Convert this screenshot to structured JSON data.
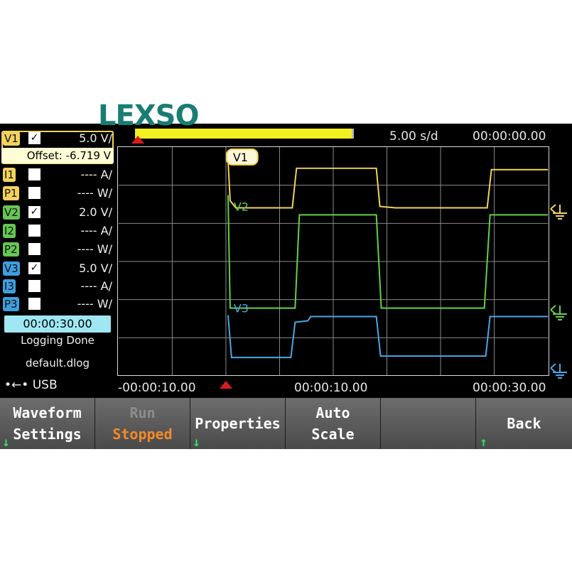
{
  "watermark": "LEXSO",
  "header": {
    "time_per_div": "5.00 s/d",
    "clock": "00:00:00.00"
  },
  "channels": [
    {
      "tag": "V1",
      "checked": "✓",
      "value": "5.0 V/"
    },
    {
      "tag": "I1",
      "checked": "",
      "value": "---- A/"
    },
    {
      "tag": "P1",
      "checked": "",
      "value": "---- W/"
    },
    {
      "tag": "V2",
      "checked": "✓",
      "value": "2.0 V/"
    },
    {
      "tag": "I2",
      "checked": "",
      "value": "---- A/"
    },
    {
      "tag": "P2",
      "checked": "",
      "value": "---- W/"
    },
    {
      "tag": "V3",
      "checked": "✓",
      "value": "5.0 V/"
    },
    {
      "tag": "I3",
      "checked": "",
      "value": "---- A/"
    },
    {
      "tag": "P3",
      "checked": "",
      "value": "---- W/"
    }
  ],
  "offset": "Offset: -6.719 V",
  "logging": {
    "duration": "00:00:30.00",
    "status": "Logging Done",
    "filename": "default.dlog",
    "storage": "USB"
  },
  "plot": {
    "trace_labels": {
      "v1": "V1",
      "v2": "V2",
      "v3": "V3"
    },
    "colors": {
      "v1": "#f3d35e",
      "v2": "#5fd24a",
      "v3": "#49a8e8",
      "grid": "#8a8a8a"
    },
    "x_labels": [
      "-00:00:10.00",
      "00:00:10.00",
      "00:00:30.00"
    ]
  },
  "softkeys": {
    "k1_l1": "Waveform",
    "k1_l2": "Settings",
    "k2_l1": "Run",
    "k2_l2": "Stopped",
    "k3": "Properties",
    "k4_l1": "Auto",
    "k4_l2": "Scale",
    "k6": "Back"
  }
}
